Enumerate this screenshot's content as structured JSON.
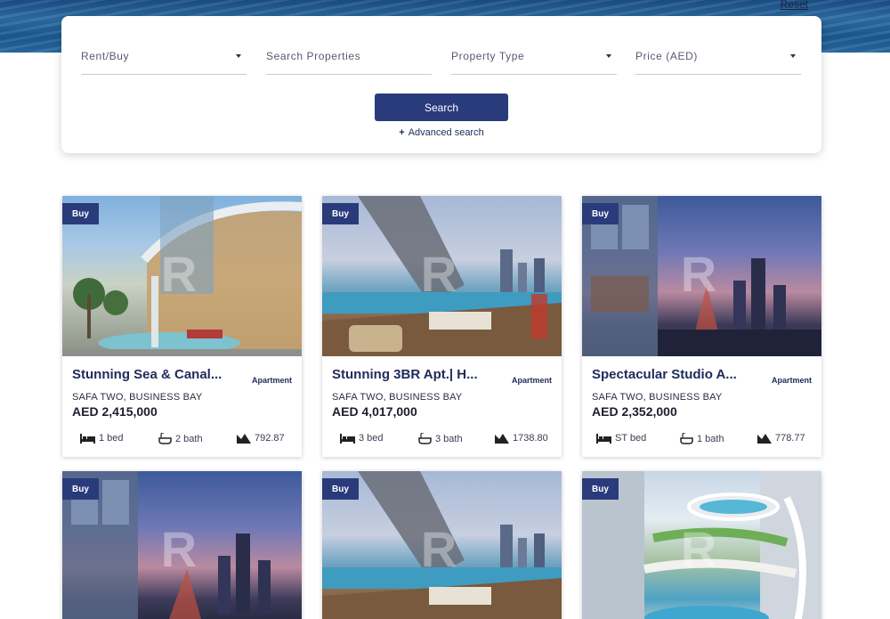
{
  "header": {
    "reset_label": "Reset"
  },
  "search": {
    "rent_buy_label": "Rent/Buy",
    "search_placeholder": "Search Properties",
    "property_type_label": "Property Type",
    "price_label": "Price (AED)",
    "search_button": "Search",
    "advanced_label": "Advanced search",
    "advanced_icon": "plus-icon"
  },
  "listings": [
    {
      "badge": "Buy",
      "title": "Stunning Sea & Canal...",
      "type": "Apartment",
      "location": "SAFA TWO, BUSINESS BAY",
      "price": "AED 2,415,000",
      "beds": "1 bed",
      "baths": "2 bath",
      "area": "792.87"
    },
    {
      "badge": "Buy",
      "title": "Stunning 3BR Apt.| H...",
      "type": "Apartment",
      "location": "SAFA TWO, BUSINESS BAY",
      "price": "AED 4,017,000",
      "beds": "3 bed",
      "baths": "3 bath",
      "area": "1738.80"
    },
    {
      "badge": "Buy",
      "title": "Spectacular Studio A...",
      "type": "Apartment",
      "location": "SAFA TWO, BUSINESS BAY",
      "price": "AED 2,352,000",
      "beds": "ST bed",
      "baths": "1 bath",
      "area": "778.77"
    },
    {
      "badge": "Buy"
    },
    {
      "badge": "Buy"
    },
    {
      "badge": "Buy"
    }
  ],
  "colors": {
    "brand": "#2a3b7c",
    "title": "#1f2a5a"
  }
}
